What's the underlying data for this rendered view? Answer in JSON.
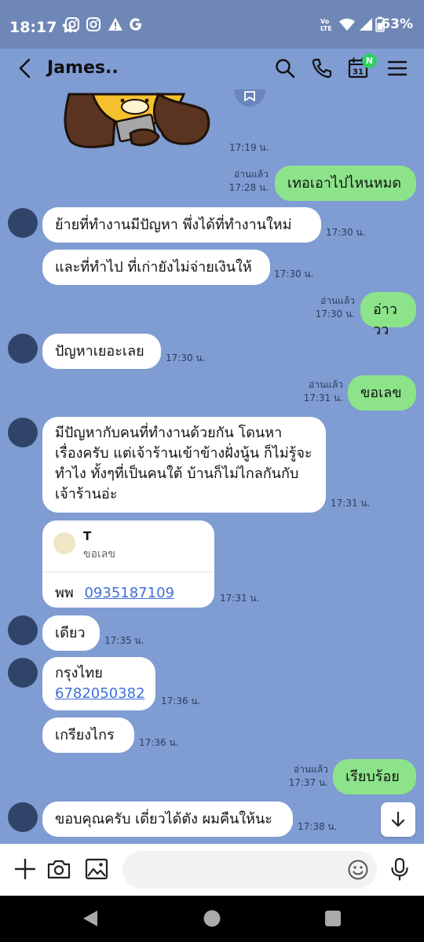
{
  "status_bar": {
    "time": "18:17 น.",
    "battery": "63%",
    "icons": [
      "instagram-icon",
      "instagram-icon",
      "warning-icon",
      "google-icon",
      "volte-icon",
      "wifi-icon",
      "signal-icon",
      "battery-icon"
    ]
  },
  "header": {
    "title": "James..",
    "calendar_day": "31",
    "calendar_badge": "N",
    "icons": [
      "back-icon",
      "search-icon",
      "phone-icon",
      "calendar-icon",
      "menu-icon"
    ]
  },
  "messages": [
    {
      "id": "m0",
      "side": "in",
      "type": "sticker",
      "time": "17:19 น."
    },
    {
      "id": "m1",
      "side": "out",
      "text": "เทอเอาไปไหนหมด",
      "read": "อ่านแล้ว",
      "time": "17:28 น."
    },
    {
      "id": "m2",
      "side": "in",
      "text": "ย้ายที่ทำงานมีปัญหา  พึ่งได้ที่ทำงานใหม่",
      "time": "17:30 น."
    },
    {
      "id": "m3",
      "side": "in",
      "text": "และที่ทำไป ที่เก่ายังไม่จ่ายเงินให้",
      "time": "17:30 น."
    },
    {
      "id": "m4",
      "side": "out",
      "text": "อ่าววว",
      "read": "อ่านแล้ว",
      "time": "17:30 น."
    },
    {
      "id": "m5",
      "side": "in",
      "text": "ปัญหาเยอะเลย",
      "time": "17:30 น."
    },
    {
      "id": "m6",
      "side": "out",
      "text": "ขอเลข",
      "read": "อ่านแล้ว",
      "time": "17:31 น."
    },
    {
      "id": "m7",
      "side": "in",
      "lines": [
        "มีปัญหากับคนที่ทำงานด้วยกัน   โดนหา",
        "เรื่องครับ แต่เจ้าร้านเข้าข้างฝั่งนู้น ก็ไม่รู้จะ",
        "ทำไง ทั้งๆที่เป็นคนใต้ บ้านก็ไม่ไกลกันกับ",
        "เจ้าร้านอ่ะ"
      ],
      "time": "17:31 น."
    },
    {
      "id": "m8",
      "side": "in",
      "type": "card",
      "name": "T",
      "sub": "ขอเลข",
      "phone_prefix": "พพ",
      "phone": "0935187109",
      "time": "17:31 น."
    },
    {
      "id": "m9",
      "side": "in",
      "text": "เดียว",
      "time": "17:35 น."
    },
    {
      "id": "m10",
      "side": "in",
      "line1": "กรุงไทย",
      "link": "6782050382",
      "time": "17:36 น."
    },
    {
      "id": "m11",
      "side": "in",
      "text": "เกรียงไกร",
      "time": "17:36 น."
    },
    {
      "id": "m12",
      "side": "out",
      "text": "เรียบร้อย",
      "read": "อ่านแล้ว",
      "time": "17:37 น."
    },
    {
      "id": "m13",
      "side": "in",
      "text": "ขอบคุณครับ  เดี่ยวได้ตัง ผมคืนให้นะ",
      "time": "17:38 น."
    }
  ],
  "input_bar": {
    "placeholder": "",
    "icons": [
      "plus-icon",
      "camera-icon",
      "image-icon",
      "emoji-icon",
      "mic-icon"
    ]
  },
  "colors": {
    "chat_background": "#7f9cd3",
    "outgoing_bubble": "#8de38a",
    "incoming_bubble": "#ffffff",
    "link": "#3f6fd8",
    "badge": "#2ecf62"
  }
}
